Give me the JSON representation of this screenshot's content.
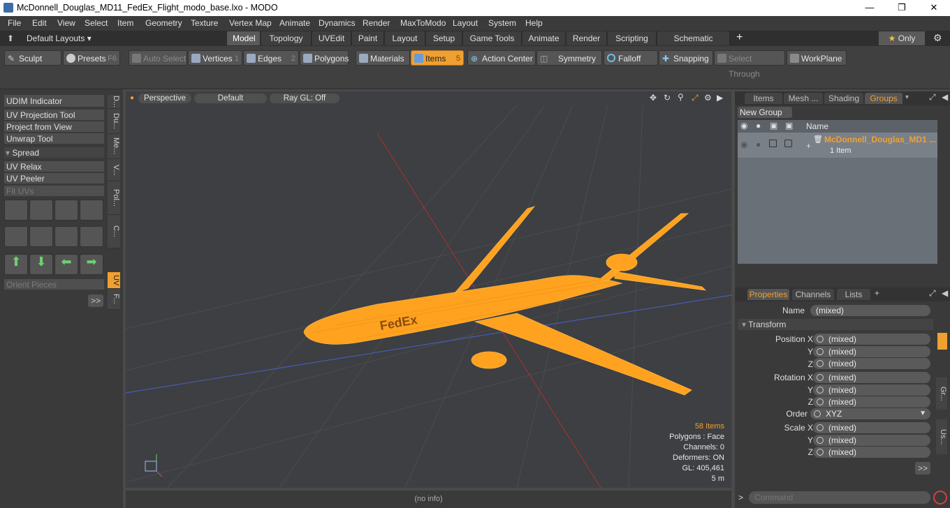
{
  "window": {
    "title": "McDonnell_Douglas_MD11_FedEx_Flight_modo_base.lxo - MODO"
  },
  "menu": [
    "File",
    "Edit",
    "View",
    "Select",
    "Item",
    "Geometry",
    "Texture",
    "Vertex Map",
    "Animate",
    "Dynamics",
    "Render",
    "MaxToModo",
    "Layout",
    "System",
    "Help"
  ],
  "layouts": {
    "dropdown": "Default Layouts",
    "tabs": [
      "Model",
      "Topology",
      "UVEdit",
      "Paint",
      "Layout",
      "Setup",
      "Game Tools",
      "Animate",
      "Render",
      "Scripting",
      "Schematic Fusion"
    ],
    "plus": "+",
    "only": "Only"
  },
  "toolbar": {
    "sculpt": "Sculpt",
    "presets": "Presets",
    "presets_key": "F6",
    "auto_select": "Auto Select",
    "vertices": "Vertices",
    "vertices_key": "1",
    "edges": "Edges",
    "edges_key": "2",
    "polygons": "Polygons",
    "materials": "Materials",
    "items": "Items",
    "items_key": "5",
    "action_center": "Action Center",
    "symmetry": "Symmetry",
    "falloff": "Falloff",
    "snapping": "Snapping",
    "select_through": "Select Through",
    "workplane": "WorkPlane"
  },
  "leftpanel": {
    "udim": "UDIM Indicator",
    "uv_projection": "UV Projection Tool",
    "project_view": "Project from View",
    "unwrap": "Unwrap Tool",
    "spread": "Spread",
    "uv_relax": "UV Relax",
    "uv_peeler": "UV Peeler",
    "fit_uvs": "Fit UVs",
    "orient": "Orient Pieces",
    "more": ">>",
    "vtabs": [
      "D...",
      "Du...",
      "Me...",
      "V...",
      "Pol...",
      "C...",
      "UV",
      "F..."
    ]
  },
  "viewport": {
    "view": "Perspective",
    "shading": "Default",
    "raygl": "Ray GL: Off",
    "items_count": "58 Items",
    "polygons": "Polygons : Face",
    "channels": "Channels: 0",
    "deformers": "Deformers: ON",
    "gl": "GL: 405,461",
    "scale": "5 m",
    "livery": "FedEx"
  },
  "status": "(no info)",
  "itemspanel": {
    "tabs": [
      "Items",
      "Mesh ...",
      "Shading",
      "Groups"
    ],
    "new_group": "New Group",
    "col_name": "Name",
    "group_name": "McDonnell_Douglas_MD1 ...",
    "group_sub": "1 Item"
  },
  "properties": {
    "tabs": [
      "Properties",
      "Channels",
      "Lists"
    ],
    "plus": "+",
    "name_label": "Name",
    "name_value": "(mixed)",
    "transform": "Transform",
    "position_x": "Position X",
    "y": "Y",
    "z": "Z",
    "rotation_x": "Rotation X",
    "order": "Order",
    "order_value": "XYZ",
    "scale_x": "Scale X",
    "mixed": "(mixed)",
    "more": ">>",
    "side_tabs": [
      "Gr...",
      "Us..."
    ]
  },
  "command": {
    "placeholder": "Command",
    "prompt": ">"
  },
  "colors": {
    "accent": "#f0a030",
    "wire": "#ffa21f",
    "bg": "#3d3f42"
  }
}
